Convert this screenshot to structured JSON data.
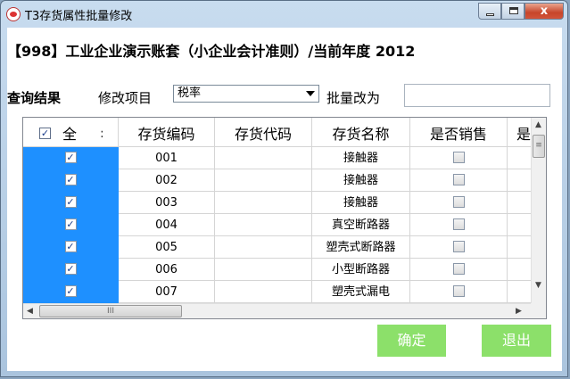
{
  "window": {
    "title": "T3存货属性批量修改",
    "close_glyph": "x"
  },
  "header": {
    "account_title": "【998】工业企业演示账套（小企业会计准则）/当前年度 2012"
  },
  "query": {
    "section_label": "查询结果",
    "modify_label": "修改项目",
    "selected_item": "税率",
    "batch_label": "批量改为",
    "batch_value": ""
  },
  "table": {
    "select_all_label": "全",
    "select_all_checked": true,
    "columns": [
      "存货编码",
      "存货代码",
      "存货名称",
      "是否销售",
      "是"
    ],
    "rows": [
      {
        "checked": true,
        "code": "001",
        "alias": "",
        "name": "接触器",
        "is_sale": false
      },
      {
        "checked": true,
        "code": "002",
        "alias": "",
        "name": "接触器",
        "is_sale": false
      },
      {
        "checked": true,
        "code": "003",
        "alias": "",
        "name": "接触器",
        "is_sale": false
      },
      {
        "checked": true,
        "code": "004",
        "alias": "",
        "name": "真空断路器",
        "is_sale": false
      },
      {
        "checked": true,
        "code": "005",
        "alias": "",
        "name": "塑壳式断路器",
        "is_sale": false
      },
      {
        "checked": true,
        "code": "006",
        "alias": "",
        "name": "小型断路器",
        "is_sale": false
      },
      {
        "checked": true,
        "code": "007",
        "alias": "",
        "name": "塑壳式漏电",
        "is_sale": false
      }
    ]
  },
  "icons": {
    "checkbox_on": "✓",
    "scroll_up": "▲",
    "scroll_down": "▼",
    "scroll_left": "◀",
    "scroll_right": "▶",
    "grip_v": "≡",
    "grip_h": "III"
  },
  "buttons": {
    "ok": "确定",
    "exit": "退出"
  },
  "colors": {
    "selected_cell": "#1e90ff",
    "button_green": "#8ce06a"
  }
}
